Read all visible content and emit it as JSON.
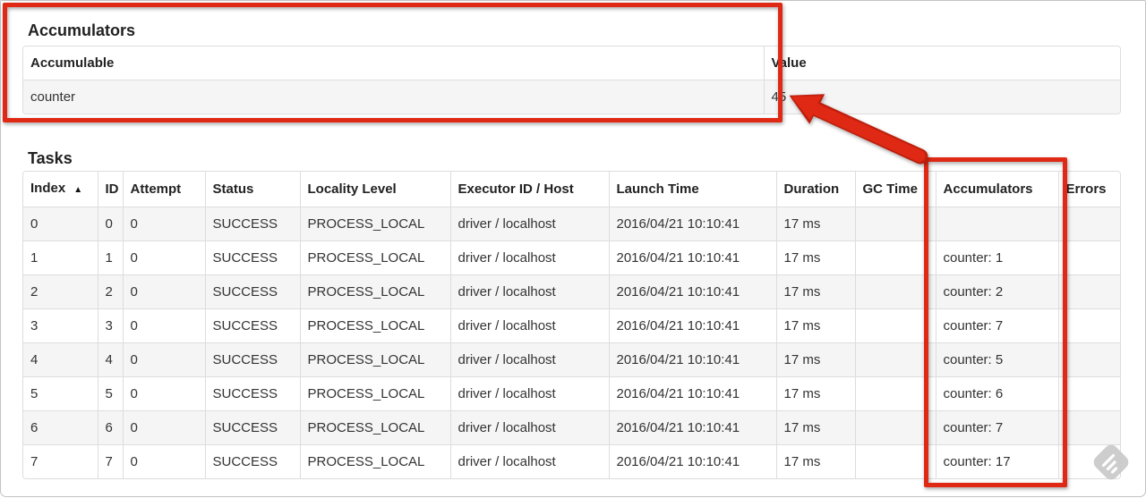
{
  "accumulators": {
    "title": "Accumulators",
    "columns": [
      "Accumulable",
      "Value"
    ],
    "rows": [
      {
        "accumulable": "counter",
        "value": "45"
      }
    ]
  },
  "tasks": {
    "title": "Tasks",
    "sort_indicator": "▲",
    "columns": [
      "Index",
      "ID",
      "Attempt",
      "Status",
      "Locality Level",
      "Executor ID / Host",
      "Launch Time",
      "Duration",
      "GC Time",
      "Accumulators",
      "Errors"
    ],
    "rows": [
      {
        "index": "0",
        "id": "0",
        "attempt": "0",
        "status": "SUCCESS",
        "locality_level": "PROCESS_LOCAL",
        "executor_id_host": "driver / localhost",
        "launch_time": "2016/04/21 10:10:41",
        "duration": "17 ms",
        "gc_time": "",
        "accumulators": "",
        "errors": ""
      },
      {
        "index": "1",
        "id": "1",
        "attempt": "0",
        "status": "SUCCESS",
        "locality_level": "PROCESS_LOCAL",
        "executor_id_host": "driver / localhost",
        "launch_time": "2016/04/21 10:10:41",
        "duration": "17 ms",
        "gc_time": "",
        "accumulators": "counter: 1",
        "errors": ""
      },
      {
        "index": "2",
        "id": "2",
        "attempt": "0",
        "status": "SUCCESS",
        "locality_level": "PROCESS_LOCAL",
        "executor_id_host": "driver / localhost",
        "launch_time": "2016/04/21 10:10:41",
        "duration": "17 ms",
        "gc_time": "",
        "accumulators": "counter: 2",
        "errors": ""
      },
      {
        "index": "3",
        "id": "3",
        "attempt": "0",
        "status": "SUCCESS",
        "locality_level": "PROCESS_LOCAL",
        "executor_id_host": "driver / localhost",
        "launch_time": "2016/04/21 10:10:41",
        "duration": "17 ms",
        "gc_time": "",
        "accumulators": "counter: 7",
        "errors": ""
      },
      {
        "index": "4",
        "id": "4",
        "attempt": "0",
        "status": "SUCCESS",
        "locality_level": "PROCESS_LOCAL",
        "executor_id_host": "driver / localhost",
        "launch_time": "2016/04/21 10:10:41",
        "duration": "17 ms",
        "gc_time": "",
        "accumulators": "counter: 5",
        "errors": ""
      },
      {
        "index": "5",
        "id": "5",
        "attempt": "0",
        "status": "SUCCESS",
        "locality_level": "PROCESS_LOCAL",
        "executor_id_host": "driver / localhost",
        "launch_time": "2016/04/21 10:10:41",
        "duration": "17 ms",
        "gc_time": "",
        "accumulators": "counter: 6",
        "errors": ""
      },
      {
        "index": "6",
        "id": "6",
        "attempt": "0",
        "status": "SUCCESS",
        "locality_level": "PROCESS_LOCAL",
        "executor_id_host": "driver / localhost",
        "launch_time": "2016/04/21 10:10:41",
        "duration": "17 ms",
        "gc_time": "",
        "accumulators": "counter: 7",
        "errors": ""
      },
      {
        "index": "7",
        "id": "7",
        "attempt": "0",
        "status": "SUCCESS",
        "locality_level": "PROCESS_LOCAL",
        "executor_id_host": "driver / localhost",
        "launch_time": "2016/04/21 10:10:41",
        "duration": "17 ms",
        "gc_time": "",
        "accumulators": "counter: 17",
        "errors": ""
      }
    ]
  },
  "annotations": {
    "color": "#e02914",
    "arrow_points_to": "45"
  },
  "icons": {
    "sort": "sort-ascending-triangle",
    "watermark": "feedly-logo"
  }
}
